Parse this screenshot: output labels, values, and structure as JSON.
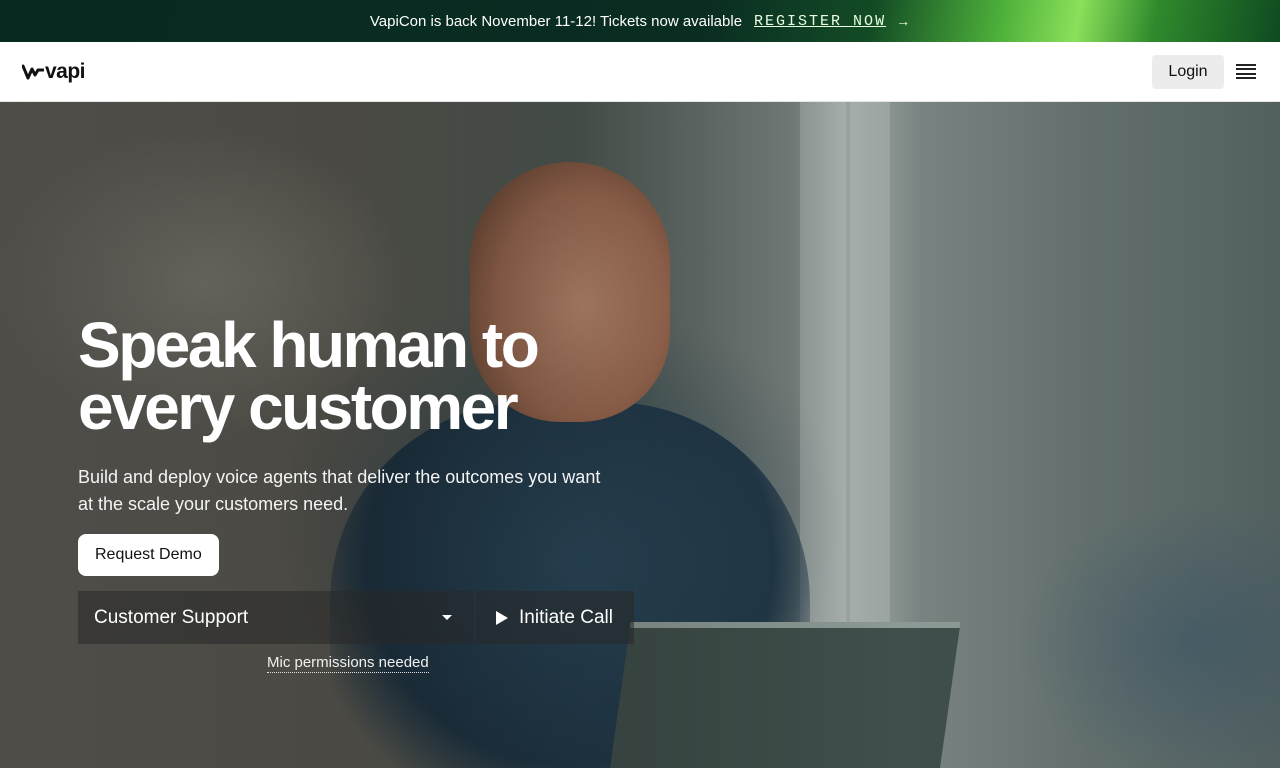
{
  "announcement": {
    "text": "VapiCon is back November 11-12! Tickets now available",
    "cta": "REGISTER NOW",
    "arrow": "→"
  },
  "header": {
    "logo_text": "vapi",
    "login_label": "Login",
    "menu_icon": "hamburger-icon"
  },
  "hero": {
    "title_line1": "Speak human to",
    "title_line2": "every customer",
    "subtitle": "Build and deploy voice agents that deliver the outcomes you want at the scale your customers need.",
    "demo_label": "Request Demo",
    "use_case_selected": "Customer Support",
    "call_label": "Initiate Call",
    "mic_note": "Mic permissions needed"
  }
}
